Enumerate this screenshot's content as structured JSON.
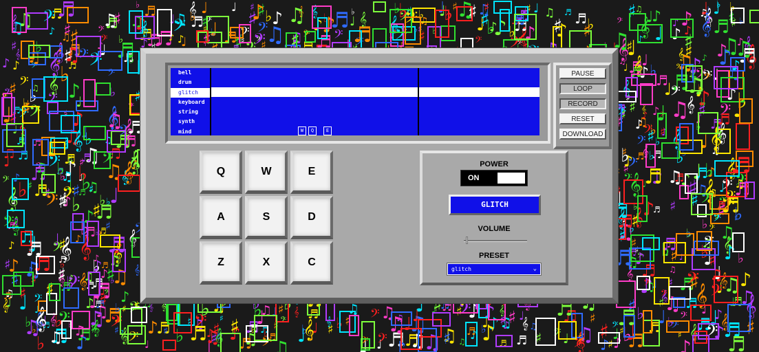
{
  "background": {
    "glyphs": [
      "♪",
      "♫",
      "♬",
      "♩",
      "𝄞",
      "𝄢",
      "♭",
      "♯"
    ],
    "colors": [
      "#ff2020",
      "#ff8c00",
      "#ffe600",
      "#30e030",
      "#00e5ff",
      "#2f6bff",
      "#b03cff",
      "#ff3cc8",
      "#7dff3c",
      "#ffffff"
    ]
  },
  "screen": {
    "tracks": [
      "bell",
      "drum",
      "glitch",
      "keyboard",
      "string",
      "synth",
      "mind"
    ],
    "active_track": "glitch",
    "sequence_keys": [
      "W",
      "Q",
      "E"
    ]
  },
  "controls": {
    "pause": "PAUSE",
    "loop": "LOOP",
    "record": "RECORD",
    "reset": "RESET",
    "download": "DOWNLOAD"
  },
  "keypad": {
    "keys": [
      "Q",
      "W",
      "E",
      "A",
      "S",
      "D",
      "Z",
      "X",
      "C"
    ]
  },
  "panel": {
    "power_label": "POWER",
    "power_state": "ON",
    "display_text": "GLITCH",
    "volume_label": "VOLUME",
    "volume_level": 0.05,
    "preset_label": "PRESET",
    "preset_value": "glitch",
    "preset_chevron": "⌄"
  },
  "colors": {
    "screen_blue": "#1010e8",
    "device_gray": "#a9a9a9"
  }
}
